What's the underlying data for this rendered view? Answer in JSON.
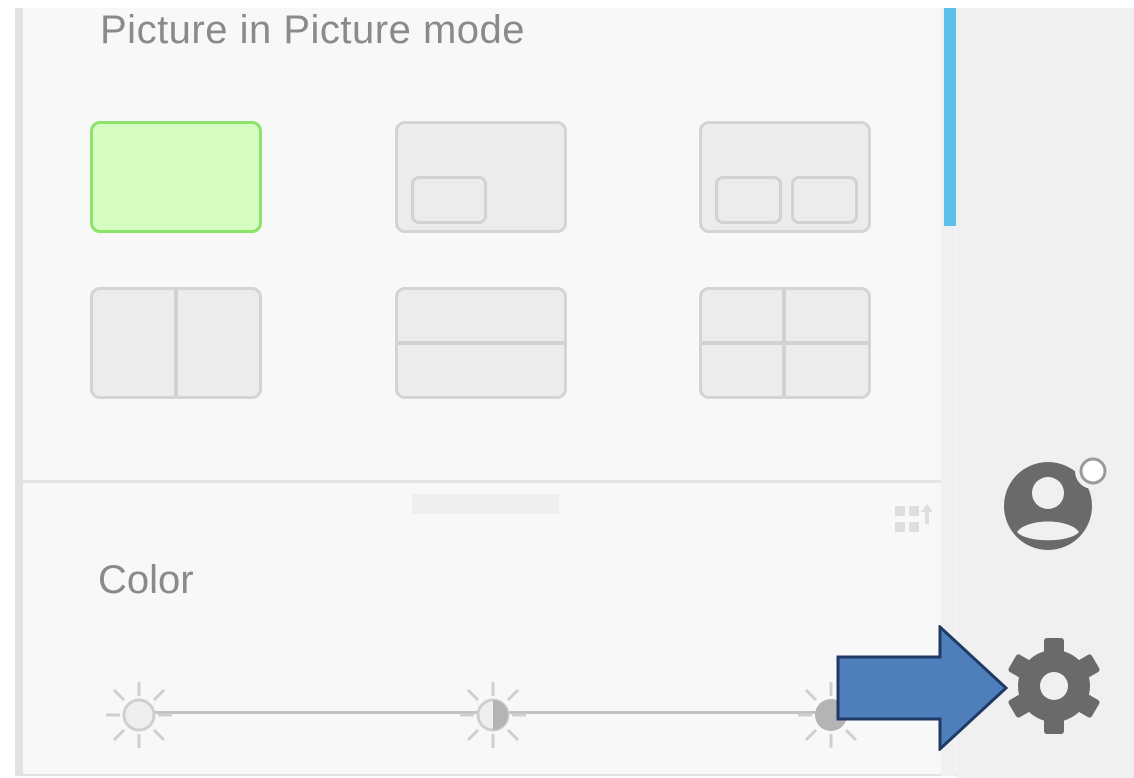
{
  "pip": {
    "title": "Picture in Picture mode",
    "layouts": [
      {
        "name": "single",
        "selected": true
      },
      {
        "name": "one-inset",
        "selected": false
      },
      {
        "name": "two-inset",
        "selected": false
      },
      {
        "name": "split-vertical",
        "selected": false
      },
      {
        "name": "split-horizontal",
        "selected": false
      },
      {
        "name": "quad",
        "selected": false
      }
    ]
  },
  "color": {
    "title": "Color",
    "slider_icons": [
      "sun-light-icon",
      "sun-half-icon",
      "sun-dark-icon"
    ]
  },
  "rail": {
    "icons": [
      "person-icon",
      "gear-icon"
    ]
  },
  "colors": {
    "selected_fill": "#d7fcc2",
    "selected_border": "#8be36a",
    "scroll_thumb": "#5cc0ea",
    "arrow": "#4f7fbb"
  }
}
